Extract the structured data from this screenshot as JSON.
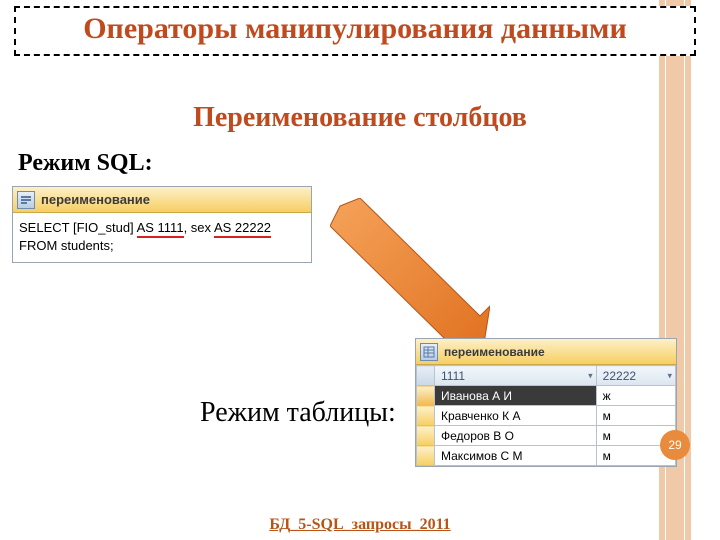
{
  "title": "Операторы манипулирования данными",
  "subtitle": "Переименование столбцов",
  "sql_mode_label": "Режим SQL:",
  "table_mode_label": "Режим таблицы:",
  "tab_name": "переименование",
  "sql": {
    "select_kw": "SELECT",
    "col1": "[FIO_stud]",
    "as1": "AS 1111",
    "sep": ", ",
    "col2": "sex",
    "as2": "AS 22222",
    "from_line": "FROM students;"
  },
  "table": {
    "headers": {
      "h1": "1111",
      "h2": "22222"
    },
    "rows": [
      {
        "c1": "Иванова А И",
        "c2": "ж",
        "selected": true
      },
      {
        "c1": "Кравченко К А",
        "c2": "м"
      },
      {
        "c1": "Федоров В О",
        "c2": "м"
      },
      {
        "c1": "Максимов С М",
        "c2": "м"
      }
    ]
  },
  "footer": "БД_5-SQL_запросы_2011",
  "page_number": "29"
}
